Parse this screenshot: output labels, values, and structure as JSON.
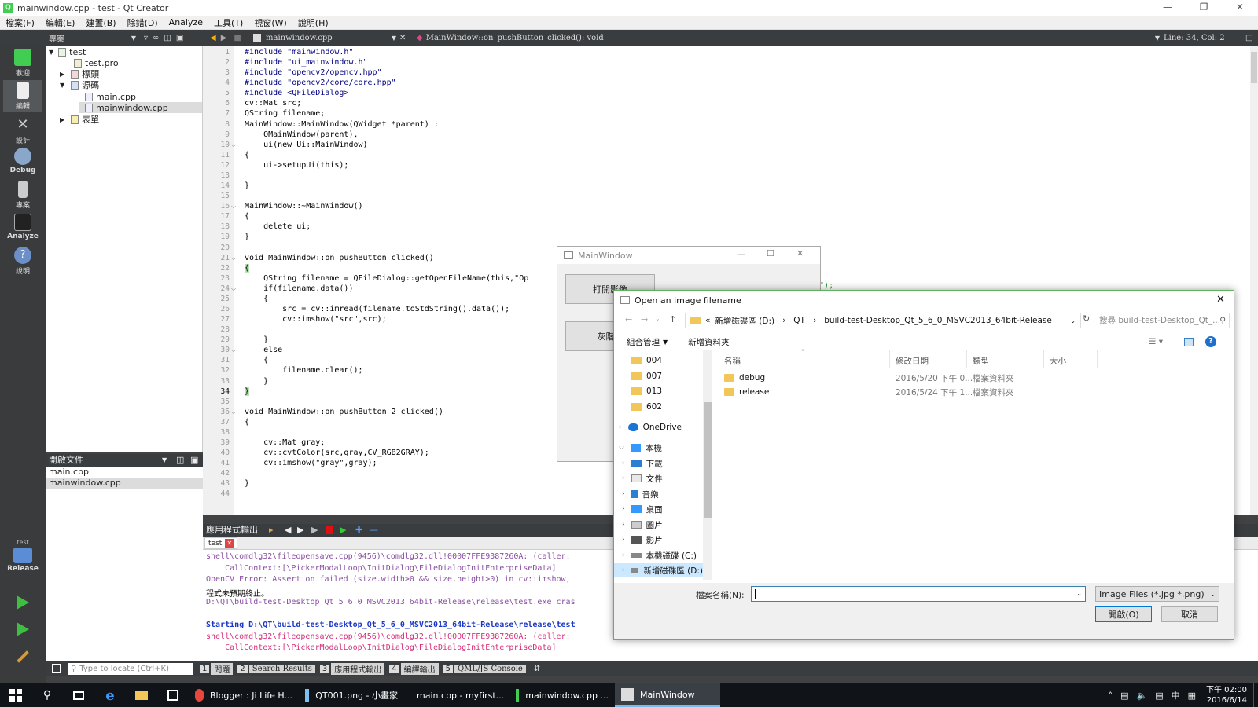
{
  "window": {
    "title": "mainwindow.cpp - test - Qt Creator"
  },
  "menu": [
    "檔案(F)",
    "編輯(E)",
    "建置(B)",
    "除錯(D)",
    "Analyze",
    "工具(T)",
    "視窗(W)",
    "說明(H)"
  ],
  "toolbar": {
    "project_label": "專案",
    "file_combo": "mainwindow.cpp",
    "function_combo": "MainWindow::on_pushButton_clicked(): void",
    "cursor_pos": "Line: 34, Col: 2"
  },
  "modes": [
    {
      "label": "歡迎"
    },
    {
      "label": "編輯"
    },
    {
      "label": "設計"
    },
    {
      "label": "Debug"
    },
    {
      "label": "專案"
    },
    {
      "label": "Analyze"
    },
    {
      "label": "說明"
    }
  ],
  "kit": {
    "project": "test",
    "build": "Release"
  },
  "project_tree": [
    {
      "label": "test",
      "depth": 0
    },
    {
      "label": "test.pro",
      "depth": 1
    },
    {
      "label": "標頭",
      "depth": 1
    },
    {
      "label": "源碼",
      "depth": 1
    },
    {
      "label": "main.cpp",
      "depth": 2
    },
    {
      "label": "mainwindow.cpp",
      "depth": 2,
      "selected": true
    },
    {
      "label": "表單",
      "depth": 1
    }
  ],
  "open_docs": {
    "title": "開啟文件",
    "items": [
      {
        "label": "main.cpp"
      },
      {
        "label": "mainwindow.cpp",
        "selected": true
      }
    ]
  },
  "code": [
    "#include \"mainwindow.h\"",
    "#include \"ui_mainwindow.h\"",
    "#include \"opencv2/opencv.hpp\"",
    "#include \"opencv2/core/core.hpp\"",
    "#include <QFileDialog>",
    "cv::Mat src;",
    "QString filename;",
    "MainWindow::MainWindow(QWidget *parent) :",
    "    QMainWindow(parent),",
    "    ui(new Ui::MainWindow)",
    "{",
    "    ui->setupUi(this);",
    "",
    "}",
    "",
    "MainWindow::~MainWindow()",
    "{",
    "    delete ui;",
    "}",
    "",
    "void MainWindow::on_pushButton_clicked()",
    "{",
    "    QString filename = QFileDialog::getOpenFileName(this,\"Op",
    "    if(filename.data())",
    "    {",
    "        src = cv::imread(filename.toStdString().data());",
    "        cv::imshow(\"src\",src);",
    "",
    "    }",
    "    else",
    "    {",
    "        filename.clear();",
    "    }",
    "}",
    "",
    "void MainWindow::on_pushButton_2_clicked()",
    "{",
    "",
    "    cv::Mat gray;",
    "    cv::cvtColor(src,gray,CV_RGB2GRAY);",
    "    cv::imshow(\"gray\",gray);",
    "",
    "}",
    ""
  ],
  "code_tail_line23": "g)\");",
  "output": {
    "title": "應用程式輸出",
    "tab": "test",
    "lines": [
      {
        "text": "shell\\comdlg32\\fileopensave.cpp(9456)\\comdlg32.dll!00007FFE9387260A: (caller:",
        "color": "#8a4fa2"
      },
      {
        "text": "    CallContext:[\\PickerModalLoop\\InitDialog\\FileDialogInitEnterpriseData]",
        "color": "#8a4fa2"
      },
      {
        "text": "OpenCV Error: Assertion failed (size.width>0 && size.height>0) in cv::imshow,",
        "color": "#8a4fa2"
      },
      {
        "text": "程式未預期終止。",
        "color": "#000000"
      },
      {
        "text": "D:\\QT\\build-test-Desktop_Qt_5_6_0_MSVC2013_64bit-Release\\release\\test.exe cras",
        "color": "#8a4fa2"
      },
      {
        "text": "",
        "color": "#000000"
      },
      {
        "text": "Starting D:\\QT\\build-test-Desktop_Qt_5_6_0_MSVC2013_64bit-Release\\release\\test",
        "color": "#1a37c8"
      },
      {
        "text": "shell\\comdlg32\\fileopensave.cpp(9456)\\comdlg32.dll!00007FFE9387260A: (caller:",
        "color": "#d6307a"
      },
      {
        "text": "    CallContext:[\\PickerModalLoop\\InitDialog\\FileDialogInitEnterpriseData]",
        "color": "#d6307a"
      }
    ]
  },
  "statusbar": {
    "locate_placeholder": "Type to locate (Ctrl+K)",
    "panes": [
      {
        "num": "1",
        "label": "問題"
      },
      {
        "num": "2",
        "label": "Search Results"
      },
      {
        "num": "3",
        "label": "應用程式輸出"
      },
      {
        "num": "4",
        "label": "編譯輸出"
      },
      {
        "num": "5",
        "label": "QML/JS Console"
      }
    ]
  },
  "mainwindow": {
    "title": "MainWindow",
    "button1": "打開影像",
    "button2": "灰階影"
  },
  "dialog": {
    "title": "Open an image filename",
    "address": [
      "«",
      "新增磁碟區 (D:)",
      "QT",
      "build-test-Desktop_Qt_5_6_0_MSVC2013_64bit-Release"
    ],
    "search_placeholder": "搜尋 build-test-Desktop_Qt_...",
    "organize": "組合管理",
    "new_folder": "新增資料夾",
    "nav": [
      {
        "label": "004",
        "type": "folder"
      },
      {
        "label": "007",
        "type": "folder"
      },
      {
        "label": "013",
        "type": "folder"
      },
      {
        "label": "602",
        "type": "folder"
      },
      {
        "label": "OneDrive",
        "type": "cloud"
      },
      {
        "label": "本機",
        "type": "pc"
      },
      {
        "label": "下載",
        "type": "down"
      },
      {
        "label": "文件",
        "type": "doc"
      },
      {
        "label": "音樂",
        "type": "music"
      },
      {
        "label": "桌面",
        "type": "desk"
      },
      {
        "label": "圖片",
        "type": "pic"
      },
      {
        "label": "影片",
        "type": "video"
      },
      {
        "label": "本機磁碟 (C:)",
        "type": "drive"
      },
      {
        "label": "新增磁碟區 (D:)",
        "type": "drive",
        "selected": true
      }
    ],
    "columns": {
      "name": "名稱",
      "date": "修改日期",
      "type": "類型",
      "size": "大小"
    },
    "files": [
      {
        "name": "debug",
        "date": "2016/5/20 下午 0...",
        "type": "檔案資料夾"
      },
      {
        "name": "release",
        "date": "2016/5/24 下午 1...",
        "type": "檔案資料夾"
      }
    ],
    "filename_label": "檔案名稱(N):",
    "filename_value": "",
    "filter": "Image Files (*.jpg *.png)",
    "open_button": "開啟(O)",
    "cancel_button": "取消"
  },
  "taskbar": {
    "items": [
      {
        "label": "Blogger : Ji Life H...",
        "icon": "chrome-icon"
      },
      {
        "label": "QT001.png - 小畫家",
        "icon": "paint-icon"
      },
      {
        "label": "main.cpp - myfirst...",
        "icon": "qt-icon"
      },
      {
        "label": "mainwindow.cpp ...",
        "icon": "qt-icon"
      },
      {
        "label": "MainWindow",
        "icon": "window-icon",
        "active": true
      }
    ],
    "time": "下午 02:00",
    "date": "2016/6/14",
    "ime": "中"
  }
}
